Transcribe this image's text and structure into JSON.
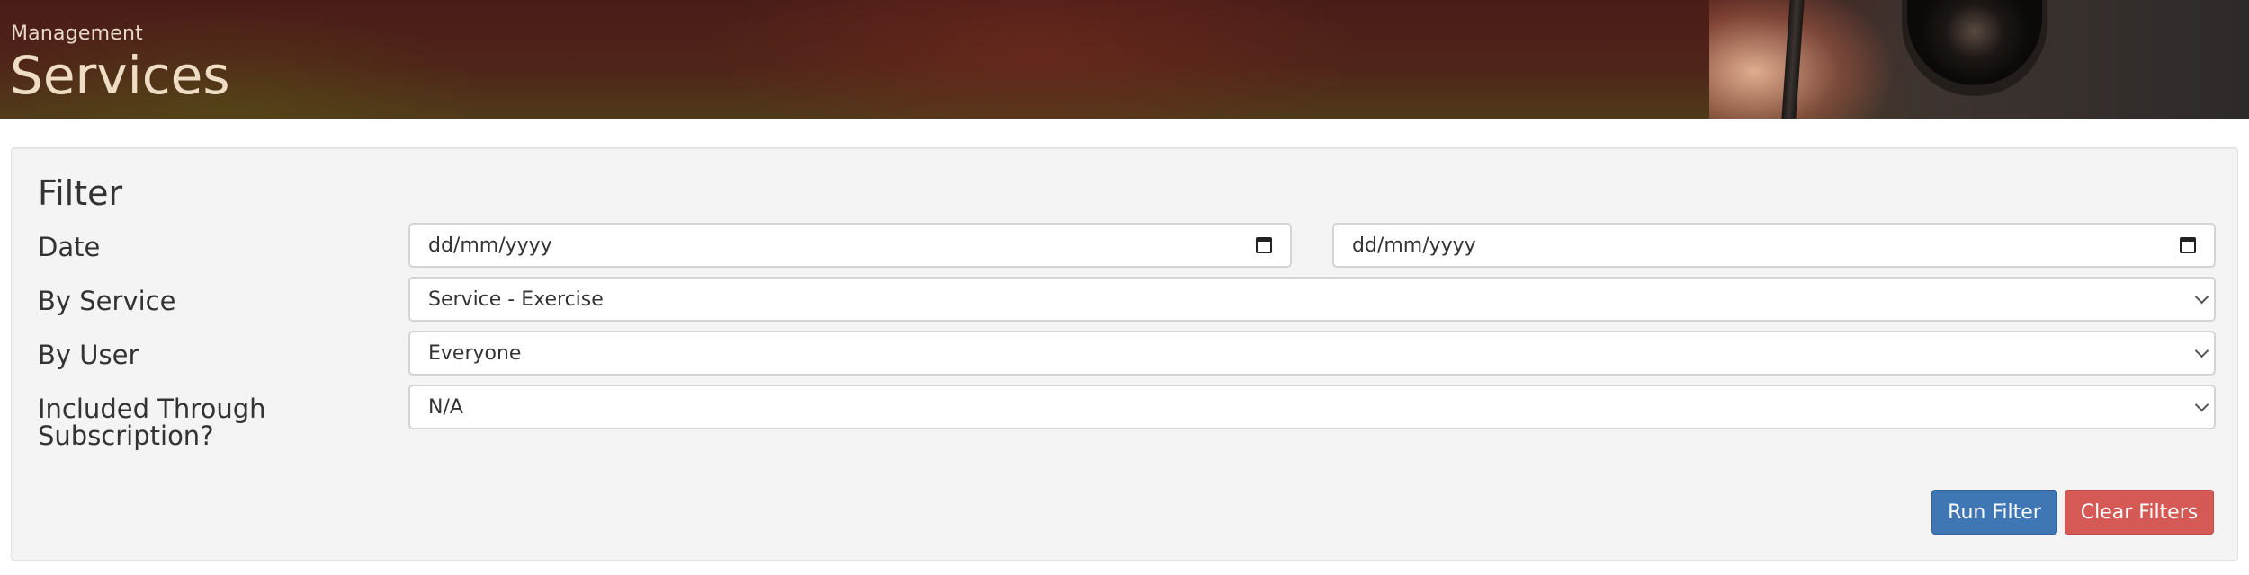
{
  "header": {
    "section": "Management",
    "title": "Services"
  },
  "filter": {
    "title": "Filter",
    "date": {
      "label": "Date",
      "from_placeholder": "dd/mm/yyyy",
      "to_placeholder": "dd/mm/yyyy"
    },
    "service": {
      "label": "By Service",
      "selected": "Service - Exercise"
    },
    "user": {
      "label": "By User",
      "selected": "Everyone"
    },
    "subscription": {
      "label_line1": "Included Through",
      "label_line2": "Subscription?",
      "selected": "N/A"
    },
    "buttons": {
      "run": "Run Filter",
      "clear": "Clear Filters"
    }
  },
  "icons": {
    "date": "calendar-icon",
    "select": "chevron-down-icon"
  },
  "colors": {
    "run_button": "#3f77b4",
    "clear_button": "#d55a55",
    "panel_bg": "#f4f4f4"
  }
}
